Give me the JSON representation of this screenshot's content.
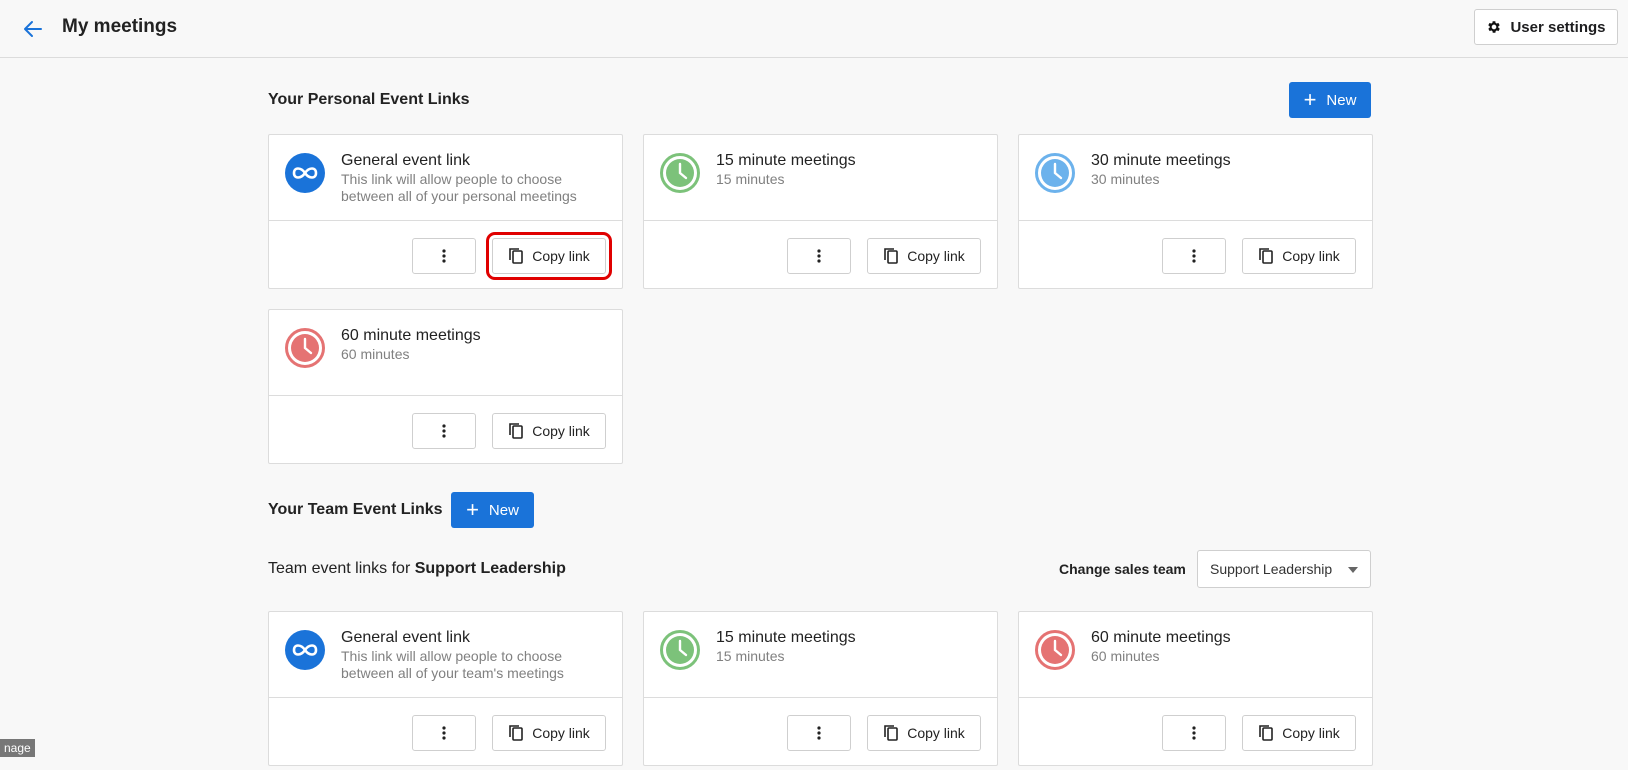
{
  "header": {
    "title": "My meetings",
    "back_icon": "arrow-left-icon",
    "user_settings_label": "User settings"
  },
  "personal": {
    "section_title": "Your Personal Event Links",
    "new_label": "New",
    "cards": [
      {
        "title": "General event link",
        "subtitle": "This link will allow people to choose between all of your personal meetings",
        "icon": "infinity-icon",
        "color": "#1a73d9",
        "copy_label": "Copy link"
      },
      {
        "title": "15 minute meetings",
        "subtitle": "15 minutes",
        "icon": "clock-icon",
        "color": "#7cc27a",
        "copy_label": "Copy link"
      },
      {
        "title": "30 minute meetings",
        "subtitle": "30 minutes",
        "icon": "clock-icon",
        "color": "#6cb2ec",
        "copy_label": "Copy link"
      },
      {
        "title": "60 minute meetings",
        "subtitle": "60 minutes",
        "icon": "clock-icon",
        "color": "#e57373",
        "copy_label": "Copy link"
      }
    ]
  },
  "team": {
    "section_title": "Your Team Event Links",
    "new_label": "New",
    "team_line_prefix": "Team event links for",
    "team_name": "Support Leadership",
    "change_label": "Change sales team",
    "select_value": "Support Leadership",
    "cards": [
      {
        "title": "General event link",
        "subtitle": "This link will allow people to choose between all of your team's meetings",
        "icon": "infinity-icon",
        "color": "#1a73d9",
        "copy_label": "Copy link"
      },
      {
        "title": "15 minute meetings",
        "subtitle": "15 minutes",
        "icon": "clock-icon",
        "color": "#7cc27a",
        "copy_label": "Copy link"
      },
      {
        "title": "60 minute meetings",
        "subtitle": "60 minutes",
        "icon": "clock-icon",
        "color": "#e57373",
        "copy_label": "Copy link"
      }
    ]
  },
  "footer_tag": "nage"
}
